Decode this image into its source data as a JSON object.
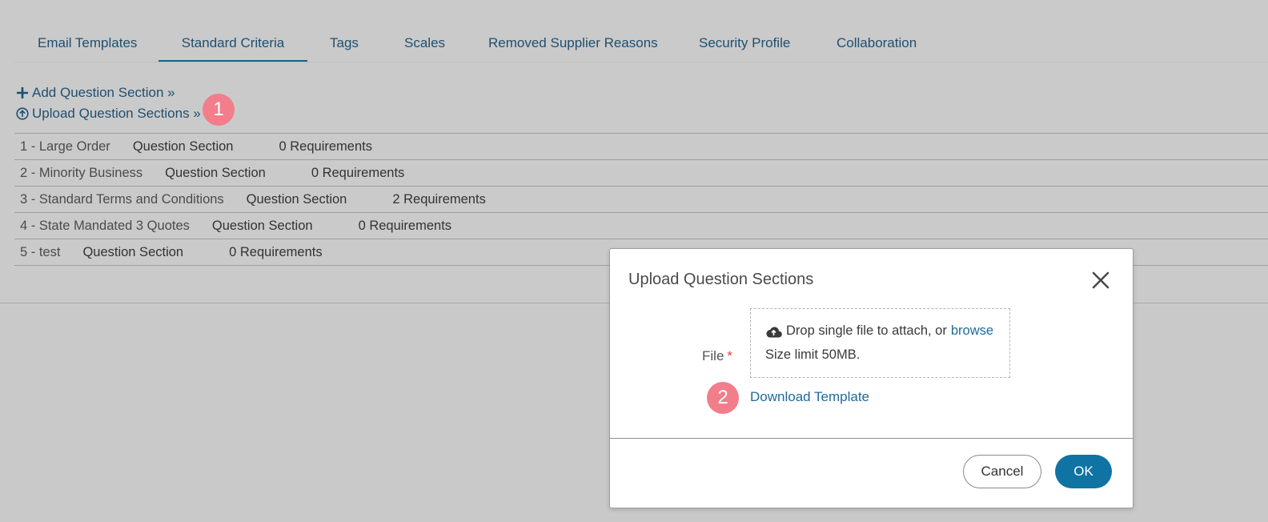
{
  "tabs": [
    {
      "label": "Email Templates"
    },
    {
      "label": "Standard Criteria",
      "active": true
    },
    {
      "label": "Tags"
    },
    {
      "label": "Scales"
    },
    {
      "label": "Removed Supplier Reasons"
    },
    {
      "label": "Security Profile"
    },
    {
      "label": "Collaboration"
    }
  ],
  "actions": {
    "add_label": "Add Question Section »",
    "add_icon": "plus-icon",
    "upload_label": "Upload Question Sections »",
    "upload_icon": "circle-arrow-up-icon"
  },
  "callouts": {
    "one": "1",
    "two": "2",
    "color": "#f27d8b"
  },
  "sections": [
    {
      "name": "1 - Large Order",
      "type": "Question Section",
      "requirements": "0 Requirements"
    },
    {
      "name": "2 - Minority Business",
      "type": "Question Section",
      "requirements": "0 Requirements"
    },
    {
      "name": "3 - Standard Terms and Conditions",
      "type": "Question Section",
      "requirements": "2 Requirements"
    },
    {
      "name": "4 - State Mandated 3 Quotes",
      "type": "Question Section",
      "requirements": "0 Requirements"
    },
    {
      "name": "5 - test",
      "type": "Question Section",
      "requirements": "0 Requirements"
    }
  ],
  "dialog": {
    "title": "Upload Question Sections",
    "file_label": "File",
    "required_mark": "*",
    "drop_text": "Drop single file to attach, or",
    "browse_link": "browse",
    "size_limit": "Size limit 50MB.",
    "download_template": "Download Template",
    "cancel_label": "Cancel",
    "ok_label": "OK",
    "accent_color": "#0f73a3"
  }
}
